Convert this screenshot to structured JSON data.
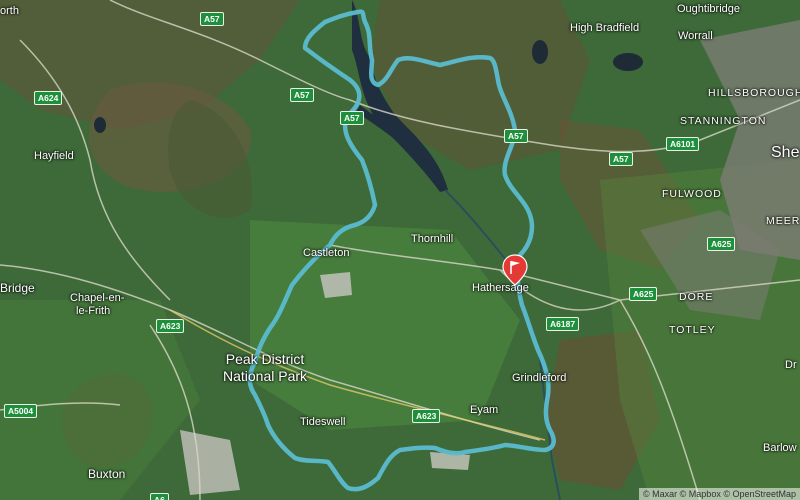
{
  "places": {
    "oughtibridge": "Oughtibridge",
    "high_bradfield": "High Bradfield",
    "worrall": "Worrall",
    "hillsborough": "HILLSBOROUGH",
    "stannington": "STANNINGTON",
    "shef": "She",
    "fulwood": "FULWOOD",
    "meer": "MEER",
    "hayfield": "Hayfield",
    "orth": "orth",
    "castleton": "Castleton",
    "thornhill": "Thornhill",
    "hathersage": "Hathersage",
    "bridge": "Bridge",
    "chapel_line1": "Chapel-en-",
    "chapel_line2": "le-Frith",
    "dore": "DORE",
    "totley": "TOTLEY",
    "grindleford": "Grindleford",
    "eyam": "Eyam",
    "tideswell": "Tideswell",
    "buxton": "Buxton",
    "barlow": "Barlow",
    "dr": "Dr",
    "park_line1": "Peak District",
    "park_line2": "National Park"
  },
  "roads": {
    "a57_top": "A57",
    "a57_mid": "A57",
    "a57_lake": "A57",
    "a57_east": "A57",
    "a57_right": "A57",
    "a624": "A624",
    "a6101": "A6101",
    "a625_1": "A625",
    "a625_2": "A625",
    "a6187": "A6187",
    "a623_1": "A623",
    "a623_2": "A623",
    "a5004": "A5004",
    "a6": "A6"
  },
  "route": {
    "color": "#5bbcd0"
  },
  "marker": {
    "icon": "flag-marker-icon",
    "color": "#e53935"
  },
  "attribution": "© Maxar © Mapbox © OpenStreetMap"
}
